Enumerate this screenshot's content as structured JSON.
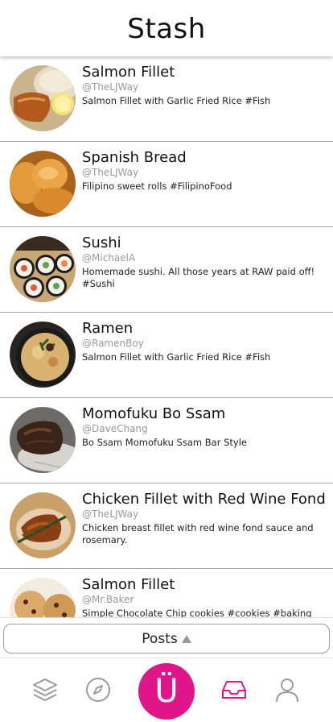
{
  "header": {
    "title": "Stash"
  },
  "posts": [
    {
      "title": "Salmon Fillet",
      "user": "@TheLJWay",
      "desc": "Salmon Fillet with Garlic Fried Rice #Fish"
    },
    {
      "title": "Spanish Bread",
      "user": "@TheLJWay",
      "desc": "Filipino sweet rolls #FilipinoFood"
    },
    {
      "title": "Sushi",
      "user": "@MichaelA",
      "desc": "Homemade sushi. All those years at RAW paid off! #Sushi"
    },
    {
      "title": "Ramen",
      "user": "@RamenBoy",
      "desc": "Salmon Fillet with Garlic Fried Rice #Fish"
    },
    {
      "title": "Momofuku Bo Ssam",
      "user": "@DaveChang",
      "desc": "Bo Ssam Momofuku Ssam Bar Style"
    },
    {
      "title": "Chicken Fillet with Red Wine Fond",
      "user": "@TheLJWay",
      "desc": "Chicken breast fillet with red wine fond sauce and rosemary."
    },
    {
      "title": "Salmon Fillet",
      "user": "@Mr.Baker",
      "desc": "Simple Chocolate Chip cookies #cookies #baking"
    }
  ],
  "posts_toggle": {
    "label": "Posts",
    "icon": "caret-up-icon"
  },
  "tabbar": {
    "items": [
      "layers-icon",
      "compass-icon",
      "app-logo-button",
      "inbox-icon",
      "profile-icon"
    ],
    "center_label": "Ü",
    "accent": "#e0158a",
    "inactive": "#9a9a9a"
  }
}
